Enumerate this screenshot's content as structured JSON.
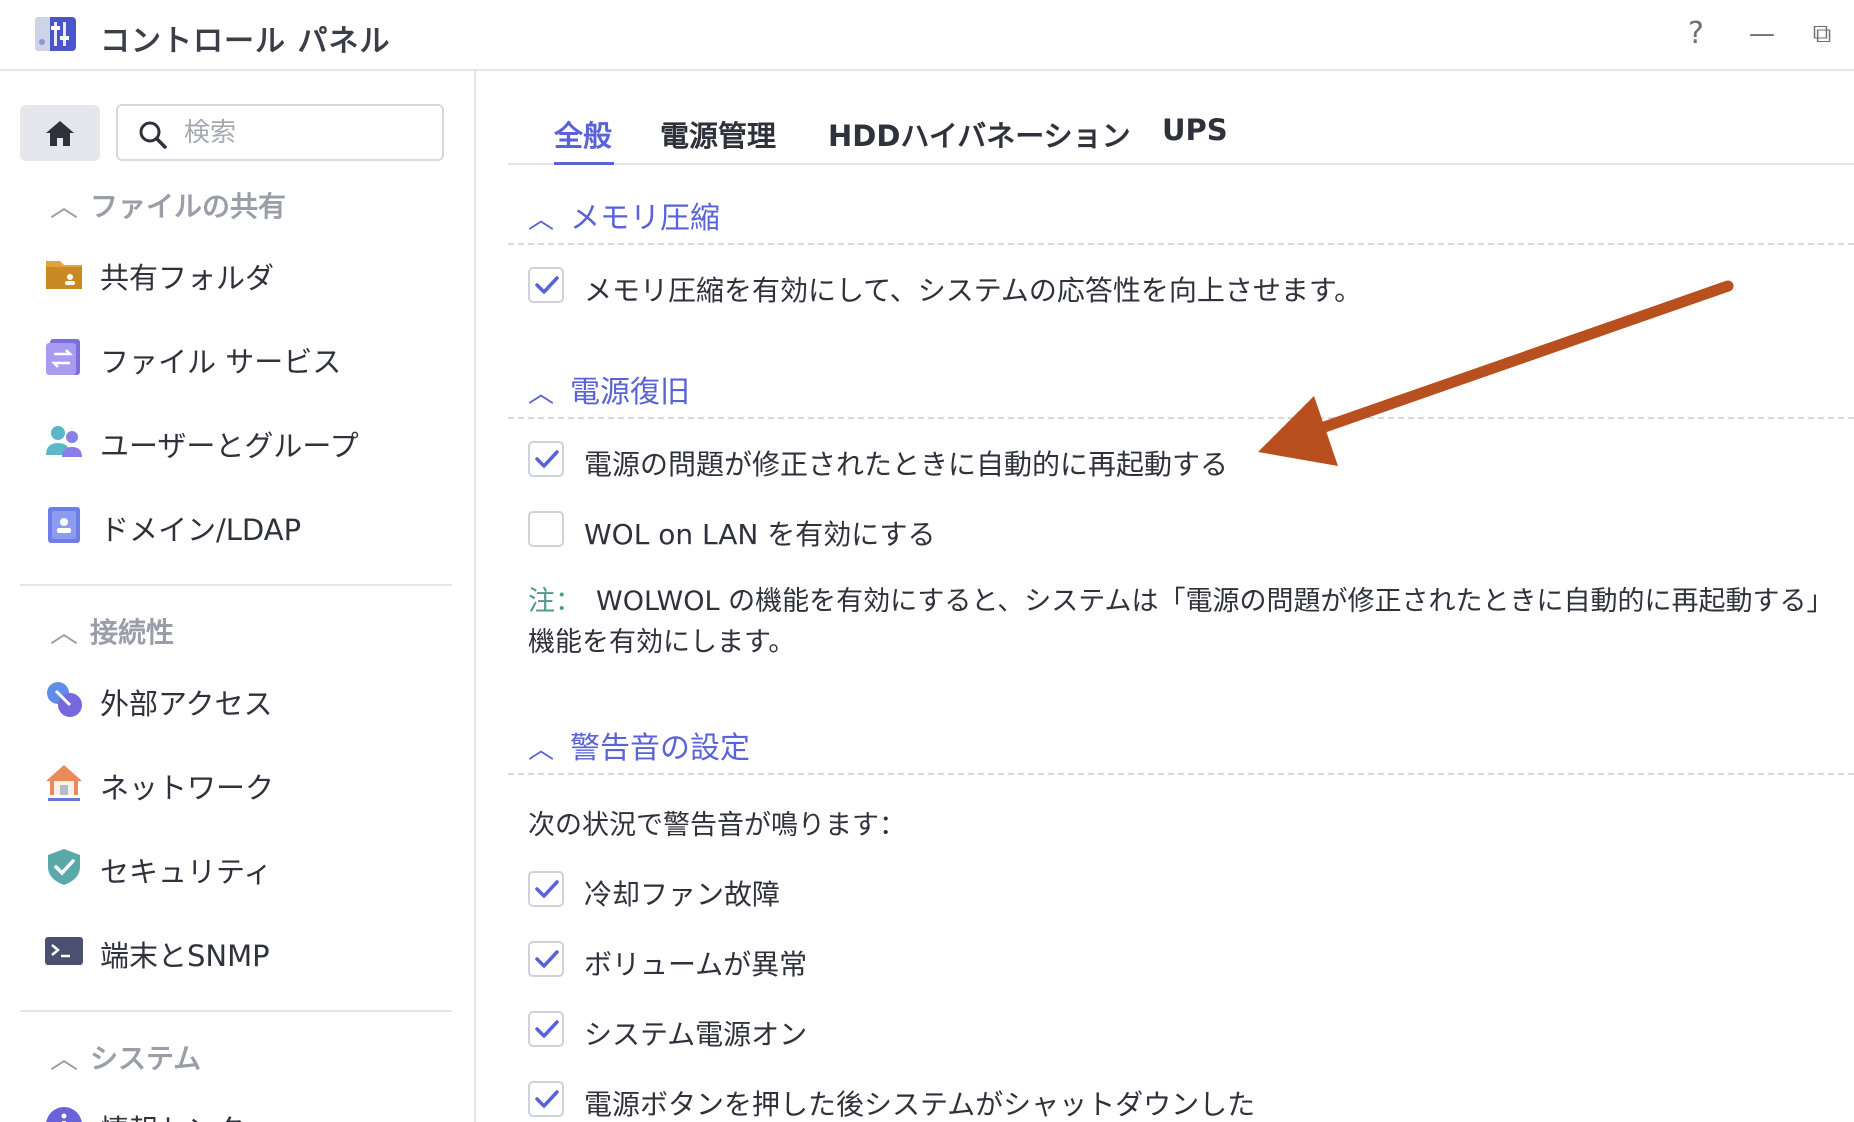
{
  "window": {
    "title": "コントロール パネル",
    "help_glyph": "?",
    "minimize_glyph": "—",
    "restore_glyph": "⧉"
  },
  "sidebar": {
    "search_placeholder": "検索",
    "groups": [
      {
        "label": "ファイルの共有",
        "items": [
          {
            "label": "共有フォルダ",
            "icon": "shared-folder-icon"
          },
          {
            "label": "ファイル サービス",
            "icon": "file-services-icon"
          },
          {
            "label": "ユーザーとグループ",
            "icon": "users-groups-icon"
          },
          {
            "label": "ドメイン/LDAP",
            "icon": "domain-ldap-icon"
          }
        ]
      },
      {
        "label": "接続性",
        "items": [
          {
            "label": "外部アクセス",
            "icon": "external-access-icon"
          },
          {
            "label": "ネットワーク",
            "icon": "network-icon"
          },
          {
            "label": "セキュリティ",
            "icon": "security-shield-icon"
          },
          {
            "label": "端末とSNMP",
            "icon": "terminal-icon"
          }
        ]
      },
      {
        "label": "システム",
        "items": [
          {
            "label": "情報センター",
            "icon": "info-center-icon"
          }
        ]
      }
    ]
  },
  "tabs": [
    {
      "label": "全般",
      "active": true
    },
    {
      "label": "電源管理",
      "active": false
    },
    {
      "label": "HDDハイバネーション",
      "active": false
    },
    {
      "label": "UPS",
      "active": false
    }
  ],
  "sections": {
    "memory": {
      "title": "メモリ圧縮",
      "options": [
        {
          "label": "メモリ圧縮を有効にして、システムの応答性を向上させます。",
          "checked": true
        }
      ]
    },
    "power_recovery": {
      "title": "電源復旧",
      "options": [
        {
          "label": "電源の問題が修正されたときに自動的に再起動する",
          "checked": true
        },
        {
          "label": "WOL on LAN を有効にする",
          "checked": false
        }
      ],
      "note_key": "注：",
      "note_text": "WOLWOL の機能を有効にすると、システムは「電源の問題が修正されたときに自動的に再起動する」機能を有効にします。"
    },
    "beep": {
      "title": "警告音の設定",
      "intro": "次の状況で警告音が鳴ります：",
      "options": [
        {
          "label": "冷却ファン故障",
          "checked": true
        },
        {
          "label": "ボリュームが異常",
          "checked": true
        },
        {
          "label": "システム電源オン",
          "checked": true
        },
        {
          "label": "電源ボタンを押した後システムがシャットダウンした",
          "checked": true
        }
      ]
    }
  },
  "colors": {
    "accent": "#5a62d8",
    "annotation_arrow": "#b84f1f",
    "note_key": "#4c9a8a"
  }
}
